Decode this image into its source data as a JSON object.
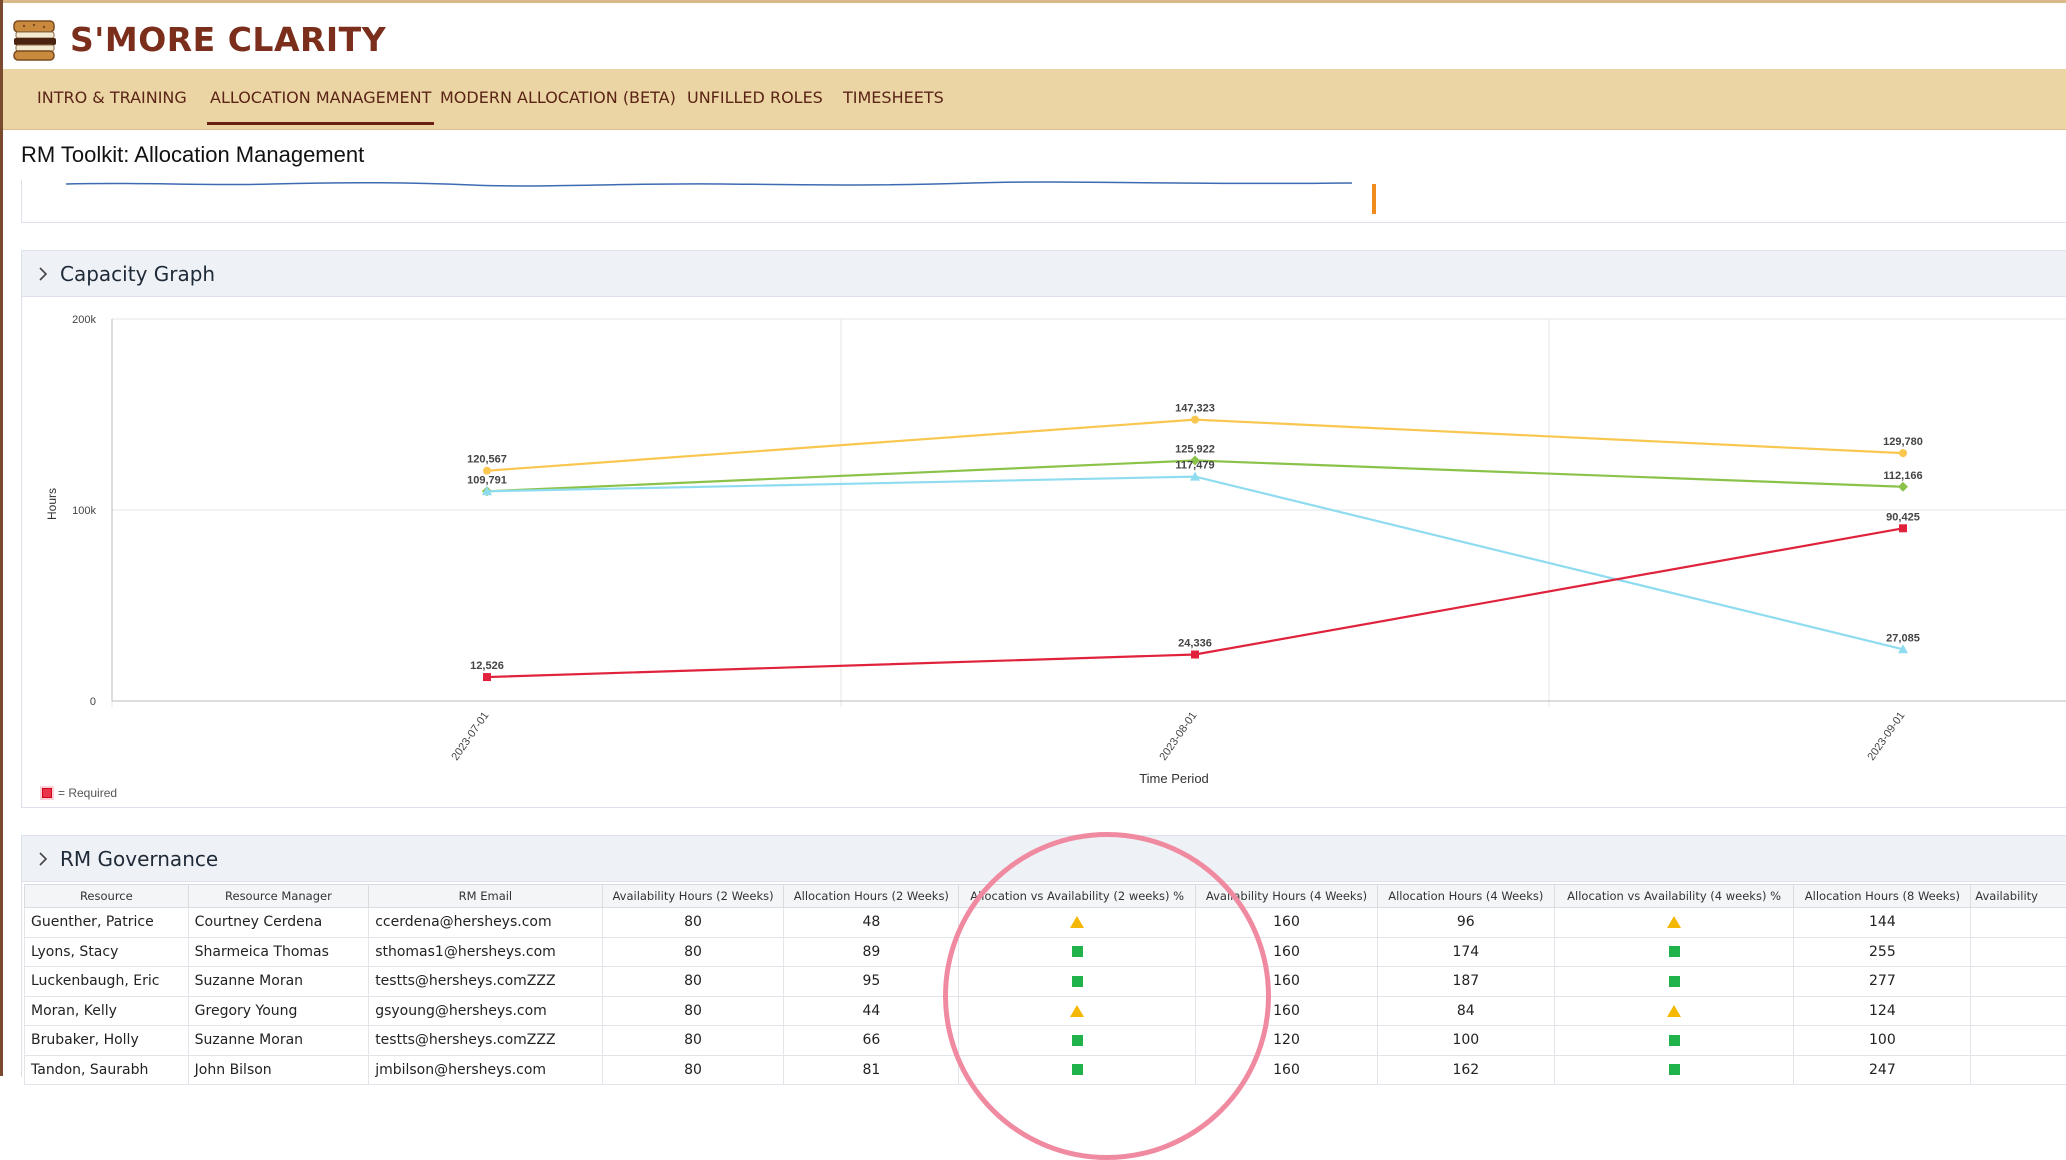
{
  "app": {
    "brand": "S'MORE CLARITY"
  },
  "nav": {
    "items": [
      "INTRO & TRAINING",
      "ALLOCATION MANAGEMENT",
      "MODERN ALLOCATION (BETA)",
      "UNFILLED ROLES",
      "TIMESHEETS"
    ],
    "active": 1
  },
  "page": {
    "title": "RM Toolkit: Allocation Management"
  },
  "capacity": {
    "title": "Capacity Graph",
    "legend": "= Required",
    "chart_data": {
      "type": "line",
      "x": [
        "2023-07-01",
        "2023-08-01",
        "2023-09-01"
      ],
      "xlabel": "Time Period",
      "ylabel": "Hours",
      "yticks": [
        "0",
        "100k",
        "200k"
      ],
      "ylim": [
        0,
        200000
      ],
      "grid": true,
      "legend_position": "bottom-left",
      "series": [
        {
          "name": "",
          "color": "#f9c74f",
          "marker": "circle",
          "values": [
            120567,
            147323,
            129780
          ],
          "labels": [
            "120,567",
            "147,323",
            "129,780"
          ]
        },
        {
          "name": "",
          "color": "#8bc34a",
          "marker": "diamond",
          "values": [
            109791,
            125922,
            112166
          ],
          "labels": [
            "109,791",
            "125,922",
            "112,166"
          ]
        },
        {
          "name": "",
          "color": "#8fdcf0",
          "marker": "triangle",
          "values": [
            109791,
            117479,
            27085
          ],
          "labels": [
            "",
            "117,479",
            "27,085"
          ]
        },
        {
          "name": "Required",
          "color": "#e0223c",
          "marker": "square",
          "values": [
            12526,
            24336,
            90425
          ],
          "labels": [
            "12,526",
            "24,336",
            "90,425"
          ]
        }
      ]
    }
  },
  "governance": {
    "title": "RM Governance",
    "columns": [
      "Resource",
      "Resource Manager",
      "RM Email",
      "Availability Hours (2 Weeks)",
      "Allocation Hours (2 Weeks)",
      "Allocation vs Availability (2 weeks) %",
      "Availability Hours (4 Weeks)",
      "Allocation Hours (4 Weeks)",
      "Allocation vs Availability (4 weeks) %",
      "Allocation Hours (8 Weeks)",
      "Availability"
    ],
    "rows": [
      {
        "resource": "Guenther, Patrice",
        "manager": "Courtney Cerdena",
        "email": "ccerdena@hersheys.com",
        "avail2": "80",
        "alloc2": "48",
        "status2": "warning",
        "avail4": "160",
        "alloc4": "96",
        "status4": "warning",
        "alloc8": "144"
      },
      {
        "resource": "Lyons, Stacy",
        "manager": "Sharmeica Thomas",
        "email": "sthomas1@hersheys.com",
        "avail2": "80",
        "alloc2": "89",
        "status2": "ok",
        "avail4": "160",
        "alloc4": "174",
        "status4": "ok",
        "alloc8": "255"
      },
      {
        "resource": "Luckenbaugh, Eric",
        "manager": "Suzanne Moran",
        "email": "testts@hersheys.comZZZ",
        "avail2": "80",
        "alloc2": "95",
        "status2": "ok",
        "avail4": "160",
        "alloc4": "187",
        "status4": "ok",
        "alloc8": "277"
      },
      {
        "resource": "Moran, Kelly",
        "manager": "Gregory Young",
        "email": "gsyoung@hersheys.com",
        "avail2": "80",
        "alloc2": "44",
        "status2": "warning",
        "avail4": "160",
        "alloc4": "84",
        "status4": "warning",
        "alloc8": "124"
      },
      {
        "resource": "Brubaker, Holly",
        "manager": "Suzanne Moran",
        "email": "testts@hersheys.comZZZ",
        "avail2": "80",
        "alloc2": "66",
        "status2": "ok",
        "avail4": "120",
        "alloc4": "100",
        "status4": "ok",
        "alloc8": "100"
      },
      {
        "resource": "Tandon, Saurabh",
        "manager": "John Bilson",
        "email": "jmbilson@hersheys.com",
        "avail2": "80",
        "alloc2": "81",
        "status2": "ok",
        "avail4": "160",
        "alloc4": "162",
        "status4": "ok",
        "alloc8": "247"
      }
    ]
  }
}
